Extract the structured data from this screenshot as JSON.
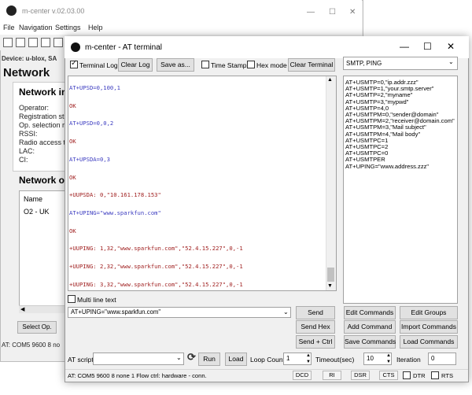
{
  "bg_window": {
    "title": "m-center v.02.03.00",
    "menu": [
      "File",
      "Navigation",
      "Settings",
      "Help"
    ],
    "device_label": "Device: u-blox, SA",
    "network_header": "Network",
    "network_info_title": "Network int",
    "fields": [
      "Operator:",
      "Registration st",
      "Op. selection r",
      "RSSI:",
      "Radio access t",
      "LAC:",
      "CI:"
    ],
    "network_op_title": "Network op",
    "list_header": "Name",
    "list_row": "O2 - UK",
    "select_op_label": "Select Op.",
    "status": "AT: COM5 9600 8 no"
  },
  "terminal_window": {
    "title": "m-center - AT terminal",
    "controls": {
      "minimize": "—",
      "maximize": "☐",
      "close": "✕"
    },
    "toolbar": {
      "terminal_log": "Terminal Log",
      "clear_log": "Clear Log",
      "save_as": "Save as...",
      "time_stamp": "Time Stamp",
      "hex_mode": "Hex mode",
      "clear_terminal": "Clear Terminal"
    },
    "terminal_lines": [
      {
        "text": "AT+UPSD=0,100,1",
        "type": "cmd"
      },
      {
        "text": "OK",
        "type": "resp"
      },
      {
        "text": "AT+UPSD=0,0,2",
        "type": "cmd"
      },
      {
        "text": "OK",
        "type": "resp"
      },
      {
        "text": "AT+UPSDA=0,3",
        "type": "cmd"
      },
      {
        "text": "OK",
        "type": "resp"
      },
      {
        "text": "+UUPSDA: 0,\"10.161.178.153\"",
        "type": "resp"
      },
      {
        "text": "AT+UPING=\"www.sparkfun.com\"",
        "type": "cmd"
      },
      {
        "text": "OK",
        "type": "resp"
      },
      {
        "text": "+UUPING: 1,32,\"www.sparkfun.com\",\"52.4.15.227\",0,-1",
        "type": "resp"
      },
      {
        "text": "+UUPING: 2,32,\"www.sparkfun.com\",\"52.4.15.227\",0,-1",
        "type": "resp"
      },
      {
        "text": "+UUPING: 3,32,\"www.sparkfun.com\",\"52.4.15.227\",0,-1",
        "type": "resp"
      }
    ],
    "multi_line_text": "Multi line text",
    "command_value": "AT+UPING=\"www.sparkfun.com\"",
    "send": "Send",
    "send_hex": "Send Hex",
    "send_ctrl": "Send + Ctrl",
    "command_group": "SMTP, PING",
    "command_list": [
      "AT+USMTP=0,\"ip.addr.zzz\"",
      "AT+USMTP=1,\"your.smtp.server\"",
      "AT+USMTP=2,\"myname\"",
      "AT+USMTP=3,\"mypwd\"",
      "AT+USMTP=4,0",
      "AT+USMTPM=0,\"sender@domain\"",
      "AT+USMTPM=2,\"receiver@domain.com\"",
      "AT+USMTPM=3,\"Mail subject\"",
      "AT+USMTPM=4,\"Mail body\"",
      "AT+USMTPC=1",
      "AT+USMTPC=2",
      "AT+USMTPC=0",
      "AT+USMTPER",
      "AT+UPING=\"www.address.zzz\""
    ],
    "edit_commands": "Edit Commands",
    "edit_groups": "Edit Groups",
    "add_command": "Add Command",
    "import_commands": "Import Commands",
    "save_commands": "Save Commands",
    "load_commands": "Load Commands",
    "at_script_label": "AT script",
    "run": "Run",
    "load": "Load",
    "loop_count_label": "Loop Count",
    "loop_count": "1",
    "timeout_label": "Timeout(sec)",
    "timeout": "10",
    "iteration_label": "Iteration",
    "iteration": "0",
    "status": "AT: COM5 9600 8 none 1 Flow ctrl: hardware - conn.",
    "leds": [
      "DCD",
      "RI",
      "DSR",
      "CTS",
      "DTR",
      "RTS"
    ]
  }
}
